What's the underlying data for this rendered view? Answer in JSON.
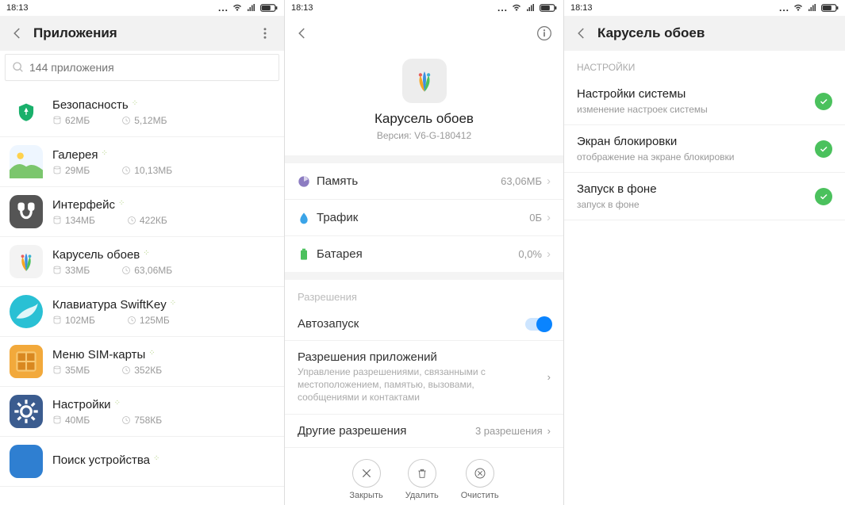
{
  "status": {
    "time": "18:13"
  },
  "panel1": {
    "title": "Приложения",
    "search_placeholder": "144 приложения",
    "apps": [
      {
        "name": "Безопасность",
        "storage": "62МБ",
        "data": "5,12МБ"
      },
      {
        "name": "Галерея",
        "storage": "29МБ",
        "data": "10,13МБ"
      },
      {
        "name": "Интерфейс",
        "storage": "134МБ",
        "data": "422КБ"
      },
      {
        "name": "Карусель обоев",
        "storage": "33МБ",
        "data": "63,06МБ"
      },
      {
        "name": "Клавиатура SwiftKey",
        "storage": "102МБ",
        "data": "125МБ"
      },
      {
        "name": "Меню SIM-карты",
        "storage": "35МБ",
        "data": "352КБ"
      },
      {
        "name": "Настройки",
        "storage": "40МБ",
        "data": "758КБ"
      },
      {
        "name": "Поиск устройства",
        "storage": "",
        "data": ""
      }
    ]
  },
  "panel2": {
    "app_name": "Карусель обоев",
    "version": "Версия: V6-G-180412",
    "memory_label": "Память",
    "memory_value": "63,06МБ",
    "traffic_label": "Трафик",
    "traffic_value": "0Б",
    "battery_label": "Батарея",
    "battery_value": "0,0%",
    "perm_section": "Разрешения",
    "autostart": "Автозапуск",
    "appperms_title": "Разрешения приложений",
    "appperms_desc": "Управление разрешениями, связанными с местоположением, памятью, вызовами, сообщениями и контактами",
    "otherperms_title": "Другие разрешения",
    "otherperms_value": "3 разрешения",
    "action_close": "Закрыть",
    "action_delete": "Удалить",
    "action_clear": "Очистить"
  },
  "panel3": {
    "title": "Карусель обоев",
    "section": "НАСТРОЙКИ",
    "items": [
      {
        "title": "Настройки системы",
        "desc": "изменение настроек системы"
      },
      {
        "title": "Экран блокировки",
        "desc": "отображение на экране блокировки"
      },
      {
        "title": "Запуск в фоне",
        "desc": "запуск в фоне"
      }
    ]
  }
}
